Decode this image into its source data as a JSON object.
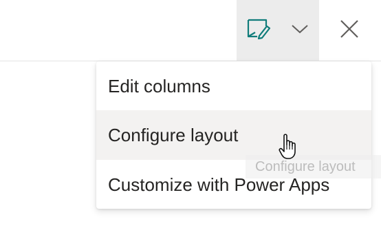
{
  "toolbar": {
    "icons": [
      "edit-view-icon",
      "chevron-down-icon",
      "close-icon"
    ],
    "accent_color": "#107c7a",
    "icon_color": "#605e5c"
  },
  "menu": {
    "items": [
      {
        "label": "Edit columns"
      },
      {
        "label": "Configure layout"
      },
      {
        "label": "Customize with Power Apps"
      }
    ]
  },
  "tooltip": {
    "text": "Configure layout"
  }
}
